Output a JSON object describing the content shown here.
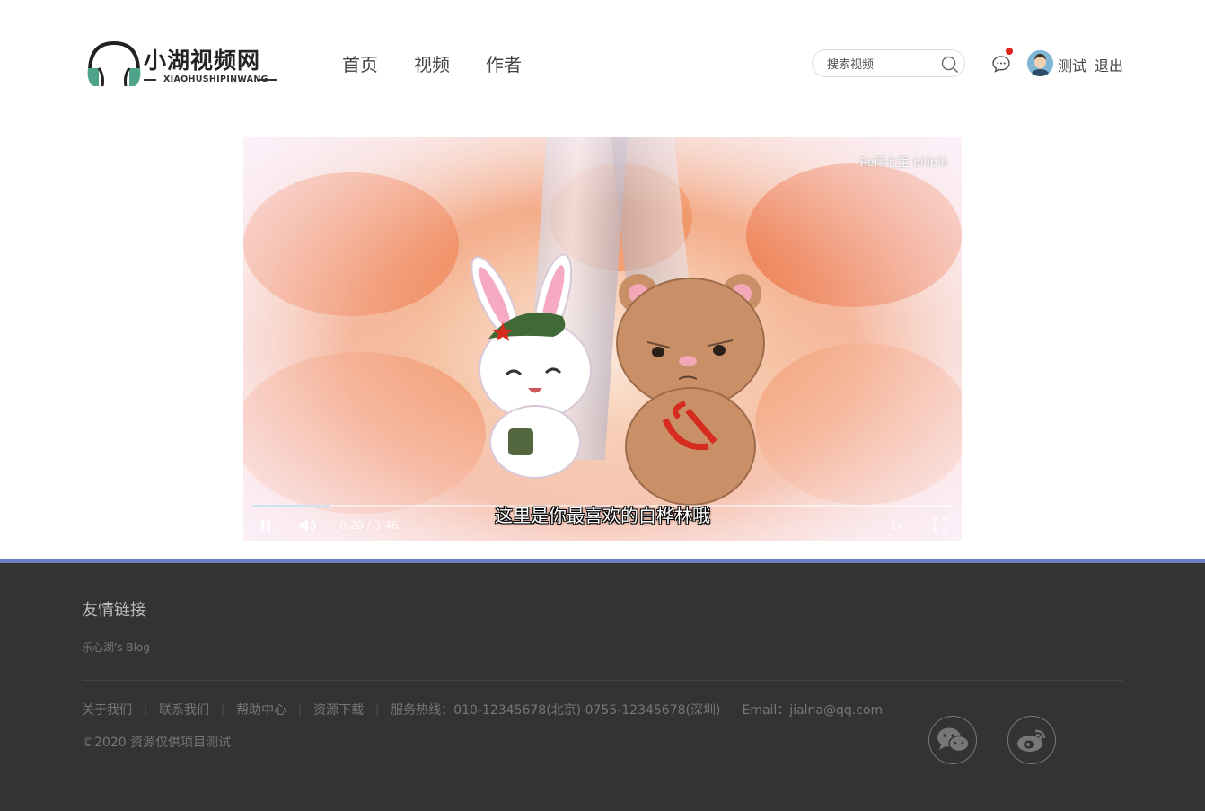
{
  "site": {
    "logo_text": "小湖视频网",
    "logo_sub": "XIAOHUSHIPINWANG"
  },
  "nav": [
    "首页",
    "视频",
    "作者"
  ],
  "search": {
    "placeholder": "搜索视频",
    "icon": "search-icon"
  },
  "user": {
    "name": "测试",
    "logout": "退出",
    "has_notification": true,
    "notification_color": "#e0211b"
  },
  "player": {
    "watermark": "Re雨七里 bilibili",
    "subtitle": "这里是你最喜欢的白桦林哦",
    "time": "0:20 / 3:46",
    "speed": "1x",
    "buffer_fraction": 0.11
  },
  "footer": {
    "friend_title": "友情链接",
    "friend_links": [
      "乐心湖's Blog"
    ],
    "links": [
      "关于我们",
      "联系我们",
      "帮助中心",
      "资源下载"
    ],
    "hotline": "服务热线：010-12345678(北京) 0755-12345678(深圳)",
    "email": "Email：jialna@qq.com",
    "copyright": "©2020 资源仅供项目测试",
    "accent_color": "#6a7fc4"
  }
}
